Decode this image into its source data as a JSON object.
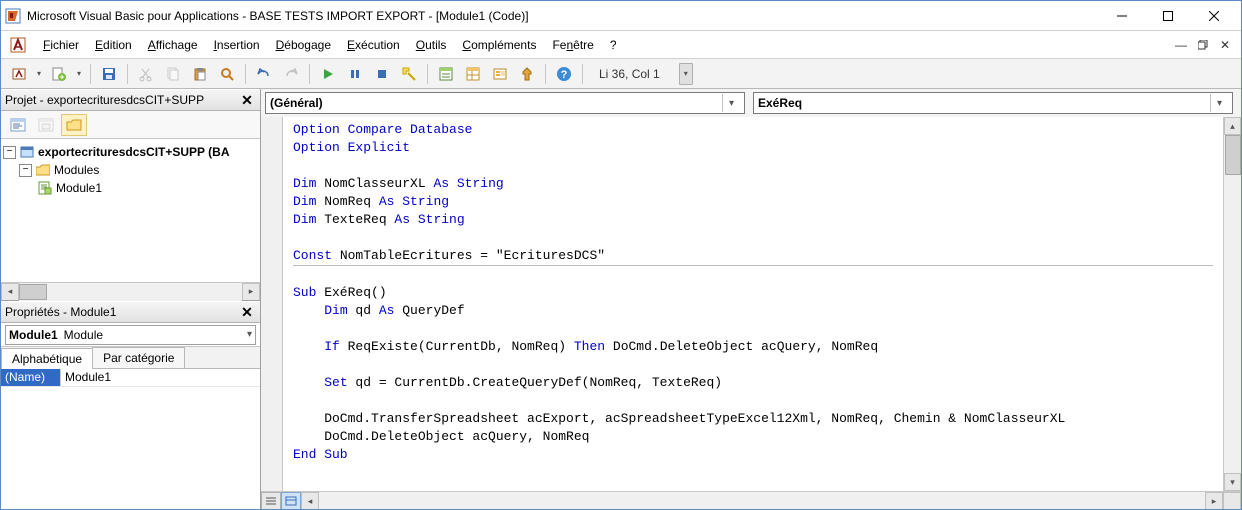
{
  "titlebar": {
    "title": "Microsoft Visual Basic pour Applications - BASE TESTS IMPORT EXPORT - [Module1 (Code)]"
  },
  "menubar": {
    "items": [
      {
        "label": "Fichier",
        "u": 0
      },
      {
        "label": "Edition",
        "u": 0
      },
      {
        "label": "Affichage",
        "u": 0
      },
      {
        "label": "Insertion",
        "u": 0
      },
      {
        "label": "Débogage",
        "u": 0
      },
      {
        "label": "Exécution",
        "u": 0
      },
      {
        "label": "Outils",
        "u": 0
      },
      {
        "label": "Compléments",
        "u": 0
      },
      {
        "label": "Fenêtre",
        "u": 2
      },
      {
        "label": "?",
        "u": -1
      }
    ]
  },
  "toolbar": {
    "cursor_pos": "Li 36, Col 1"
  },
  "project_pane": {
    "title": "Projet - exportecrituresdcsCIT+SUPP",
    "root": "exportecrituresdcsCIT+SUPP (BA",
    "folder": "Modules",
    "module": "Module1"
  },
  "props_pane": {
    "title": "Propriétés - Module1",
    "object_name": "Module1",
    "object_type": "Module",
    "tabs": [
      "Alphabétique",
      "Par catégorie"
    ],
    "rows": [
      {
        "name": "(Name)",
        "value": "Module1"
      }
    ]
  },
  "code_combos": {
    "left": "(Général)",
    "right": "ExéReq"
  },
  "code": {
    "lines": [
      {
        "t": "opt1"
      },
      {
        "t": "opt2"
      },
      {
        "t": "blank"
      },
      {
        "t": "dim1"
      },
      {
        "t": "dim2"
      },
      {
        "t": "dim3"
      },
      {
        "t": "blank"
      },
      {
        "t": "const"
      },
      {
        "t": "sepline"
      },
      {
        "t": "sub"
      },
      {
        "t": "dimqd"
      },
      {
        "t": "blank"
      },
      {
        "t": "if"
      },
      {
        "t": "blank"
      },
      {
        "t": "set"
      },
      {
        "t": "blank"
      },
      {
        "t": "docmd1"
      },
      {
        "t": "docmd2"
      },
      {
        "t": "endsub"
      }
    ],
    "text": {
      "opt1_a": "Option Compare Database",
      "opt2_a": "Option Explicit",
      "dim_kw": "Dim",
      "as_kw": "As",
      "string_kw": "String",
      "dim1_name": " NomClasseurXL ",
      "dim2_name": " NomReq ",
      "dim3_name": " TexteReq ",
      "const_kw": "Const",
      "const_rest": " NomTableEcritures = \"EcrituresDCS\"",
      "sub_kw": "Sub",
      "sub_name": " ExéReq()",
      "dimqd_pre": "    ",
      "dimqd_name": " qd ",
      "querydef": " QueryDef",
      "if_pre": "    ",
      "if_kw": "If",
      "if_mid": " ReqExiste(CurrentDb, NomReq) ",
      "then_kw": "Then",
      "if_rest": " DoCmd.DeleteObject acQuery, NomReq",
      "set_pre": "    ",
      "set_kw": "Set",
      "set_rest": " qd = CurrentDb.CreateQueryDef(NomReq, TexteReq)",
      "docmd1": "    DoCmd.TransferSpreadsheet acExport, acSpreadsheetTypeExcel12Xml, NomReq, Chemin & NomClasseurXL",
      "docmd2": "    DoCmd.DeleteObject acQuery, NomReq",
      "endsub_kw": "End Sub"
    }
  }
}
